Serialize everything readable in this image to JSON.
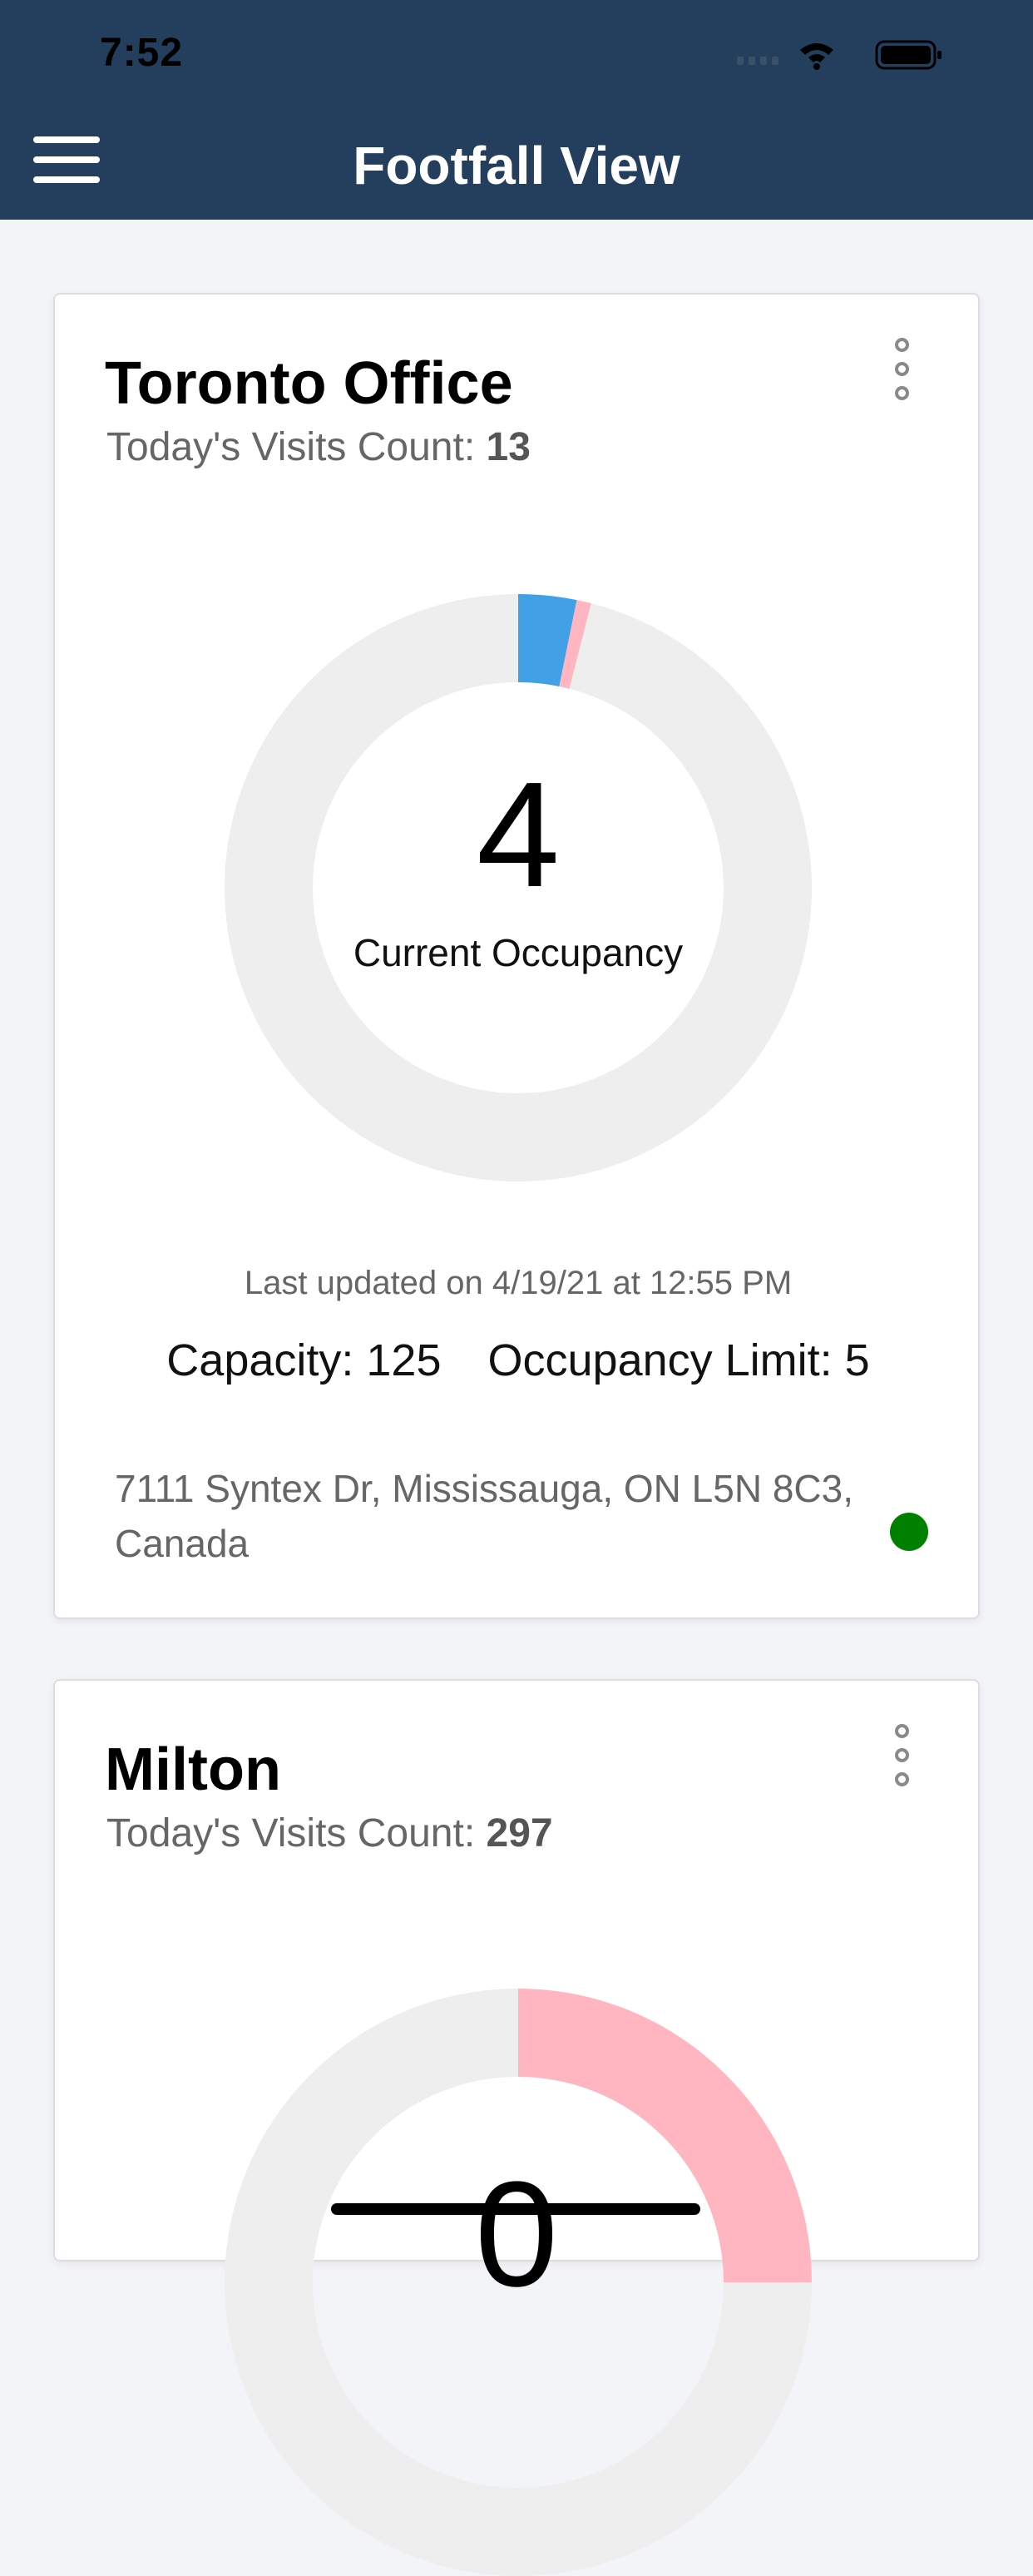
{
  "status_bar": {
    "time": "7:52"
  },
  "nav": {
    "title": "Footfall View"
  },
  "colors": {
    "header": "#243e5d",
    "ring_track": "#eeeeee",
    "occupancy": "#42a0e6",
    "limit_marker": "#ffb6c1",
    "status_ok": "#008000"
  },
  "icons": [
    "menu-icon",
    "more-vertical-icon",
    "wifi-icon",
    "battery-icon",
    "cellular-signal-icon"
  ],
  "sites": [
    {
      "name": "Toronto Office",
      "visits_label": "Today's Visits Count: ",
      "visits_value": "13",
      "occupancy": "4",
      "occupancy_label": "Current Occupancy",
      "last_updated": "Last updated on 4/19/21 at 12:55 PM",
      "capacity": "Capacity: 125",
      "occupancy_limit": "Occupancy Limit: 5",
      "address": "7111 Syntex Dr, Mississauga, ON L5N 8C3, Canada",
      "occupancy_fraction": 0.032,
      "limit_fraction": 0.04
    },
    {
      "name": "Milton",
      "visits_label": "Today's Visits Count: ",
      "visits_value": "297",
      "occupancy": "0"
    }
  ]
}
